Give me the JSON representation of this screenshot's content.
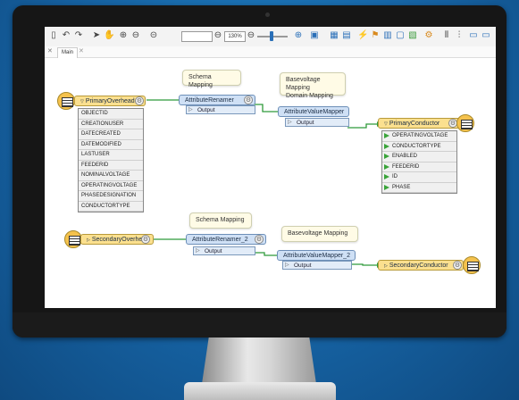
{
  "toolbar": {
    "buttons": [
      "new-icon",
      "undo-icon",
      "redo-icon",
      "pointer-icon",
      "pan-hand-icon",
      "zoom-in-icon",
      "zoom-out-icon",
      "zoom-fit-icon"
    ],
    "zoom_level": "130%"
  },
  "tabs": {
    "active": "Main"
  },
  "annotations": {
    "a1": "Schema Mapping",
    "a2_line1": "Basevoltage Mapping",
    "a2_line2": "Domain Mapping",
    "a3": "Schema Mapping",
    "a4": "Basevoltage Mapping"
  },
  "nodes": {
    "primary_overhead": "PrimaryOverhead",
    "attribute_renamer": "AttributeRenamer",
    "attribute_value_mapper": "AttributeValueMapper",
    "primary_conductor": "PrimaryConductor",
    "secondary_overhead": "SecondaryOverhead",
    "attribute_renamer_2": "AttributeRenamer_2",
    "attribute_value_mapper_2": "AttributeValueMapper_2",
    "secondary_conductor": "SecondaryConductor",
    "output_label": "Output"
  },
  "primary_overhead_attributes": [
    "OBJECTID",
    "CREATIONUSER",
    "DATECREATED",
    "DATEMODIFIED",
    "LASTUSER",
    "FEEDERID",
    "NOMINALVOLTAGE",
    "OPERATINGVOLTAGE",
    "PHASEDESIGNATION",
    "CONDUCTORTYPE"
  ],
  "primary_conductor_attributes": [
    "OPERATINGVOLTAGE",
    "CONDUCTORTYPE",
    "ENABLED",
    "FEEDERID",
    "ID",
    "PHASE"
  ],
  "colors": {
    "transformer": "#cfe0f5",
    "feature_type": "#fbe08f",
    "connection": "#2f9a3a"
  }
}
